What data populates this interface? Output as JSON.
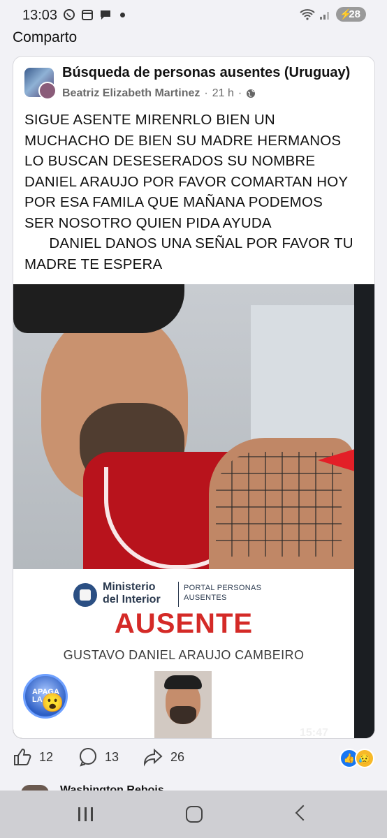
{
  "status_bar": {
    "time": "13:03",
    "battery": "28",
    "icons": [
      "whatsapp-icon",
      "calendar-icon",
      "chat-icon",
      "wifi-icon",
      "signal-icon",
      "battery-icon"
    ]
  },
  "header": {
    "shared_label": "Comparto"
  },
  "post": {
    "group_name": "Búsqueda de personas ausentes (Uruguay)",
    "author": "Beatriz Elizabeth Martinez",
    "time": "21 h",
    "separator": "·",
    "text": "SIGUE ASENTE MIRENRLO BIEN UN\nMUCHACHO DE BIEN SU MADRE HERMANOS\nLO BUSCAN DESESERADOS SU NOMBRE\nDANIEL ARAUJO POR FAVOR COMARTAN HOY\nPOR ESA FAMILA QUE MAÑANA PODEMOS\nSER NOSOTRO QUIEN PIDA AYUDA\n      DANIEL DANOS UNA SEÑAL POR FAVOR TU\nMADRE TE ESPERA"
  },
  "image": {
    "ministry": "Ministerio\ndel Interior",
    "portal": "PORTAL PERSONAS\nAUSENTES",
    "status_word": "AUSENTE",
    "full_name": "GUSTAVO DANIEL ARAUJO CAMBEIRO",
    "sticker_text": "APAGA\nLA",
    "video_time": "15:47"
  },
  "reactions": {
    "likes": "12",
    "comments": "13",
    "shares": "26"
  },
  "comment_preview": {
    "name": "Washington Rebois"
  }
}
